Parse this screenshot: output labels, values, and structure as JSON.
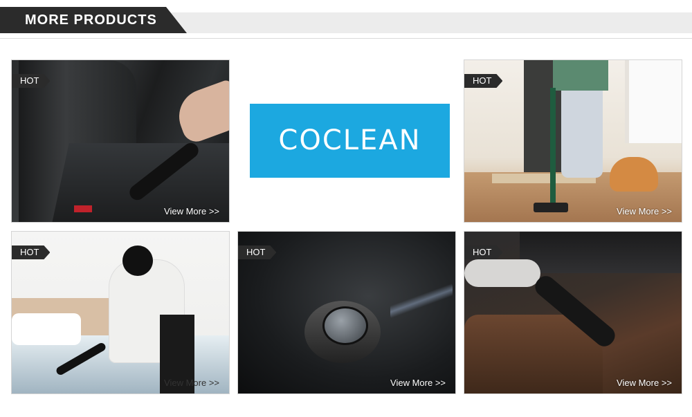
{
  "header": {
    "title": "MORE PRODUCTS"
  },
  "logo": {
    "text": "COCLEAN",
    "background": "#1ca8e0"
  },
  "colors": {
    "badge": "#2b2b2b",
    "header_strip": "#ececec"
  },
  "tiles": [
    {
      "badge": "HOT",
      "link": "View More >>"
    },
    {
      "badge": "HOT",
      "link": "View More >>"
    },
    {
      "badge": "HOT",
      "link": "View More >>"
    },
    {
      "badge": "HOT",
      "link": "View More >>"
    },
    {
      "badge": "HOT",
      "link": "View More >>"
    }
  ]
}
